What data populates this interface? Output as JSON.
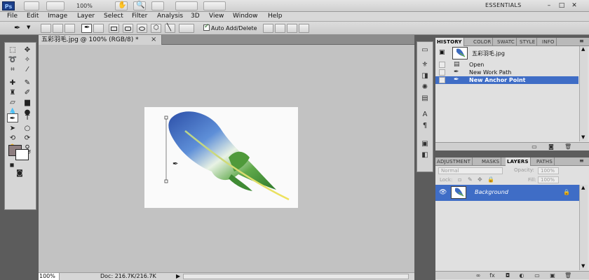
{
  "app": {
    "logo": "Ps",
    "zoom_level": "100%",
    "workspace": "ESSENTIALS",
    "minimize_glyph": "–",
    "restore_glyph": "□",
    "close_glyph": "✕"
  },
  "menu": [
    "File",
    "Edit",
    "Image",
    "Layer",
    "Select",
    "Filter",
    "Analysis",
    "3D",
    "View",
    "Window",
    "Help"
  ],
  "options": {
    "auto_add_delete": "Auto Add/Delete",
    "auto_add_checked": true
  },
  "document": {
    "tab_title": "五彩羽毛.jpg @ 100% (RGB/8) *",
    "tab_close": "×",
    "status_zoom": "100%",
    "status_info": "Doc: 216.7K/216.7K",
    "status_arrow": "▶"
  },
  "history": {
    "tabs": [
      "HISTORY",
      "COLOR",
      "SWATC",
      "STYLE",
      "INFO"
    ],
    "snapshot_name": "五彩羽毛.jpg",
    "items": [
      {
        "label": "Open",
        "icon": "document-icon",
        "selected": false
      },
      {
        "label": "New Work Path",
        "icon": "pen-icon",
        "selected": false
      },
      {
        "label": "New Anchor Point",
        "icon": "pen-icon",
        "selected": true
      }
    ]
  },
  "layers": {
    "tabs": [
      "ADJUSTMENT",
      "MASKS",
      "LAYERS",
      "PATHS"
    ],
    "blend_mode": "Normal",
    "opacity_label": "Opacity:",
    "opacity_value": "100%",
    "lock_label": "Lock:",
    "fill_label": "Fill:",
    "fill_value": "100%",
    "items": [
      {
        "name": "Background",
        "locked": true,
        "visible": true
      }
    ]
  },
  "colors": {
    "foreground": "#8e7e80",
    "background": "#ffffff",
    "selection": "#3f6dc6",
    "panel_bg": "#5c5c5c"
  }
}
